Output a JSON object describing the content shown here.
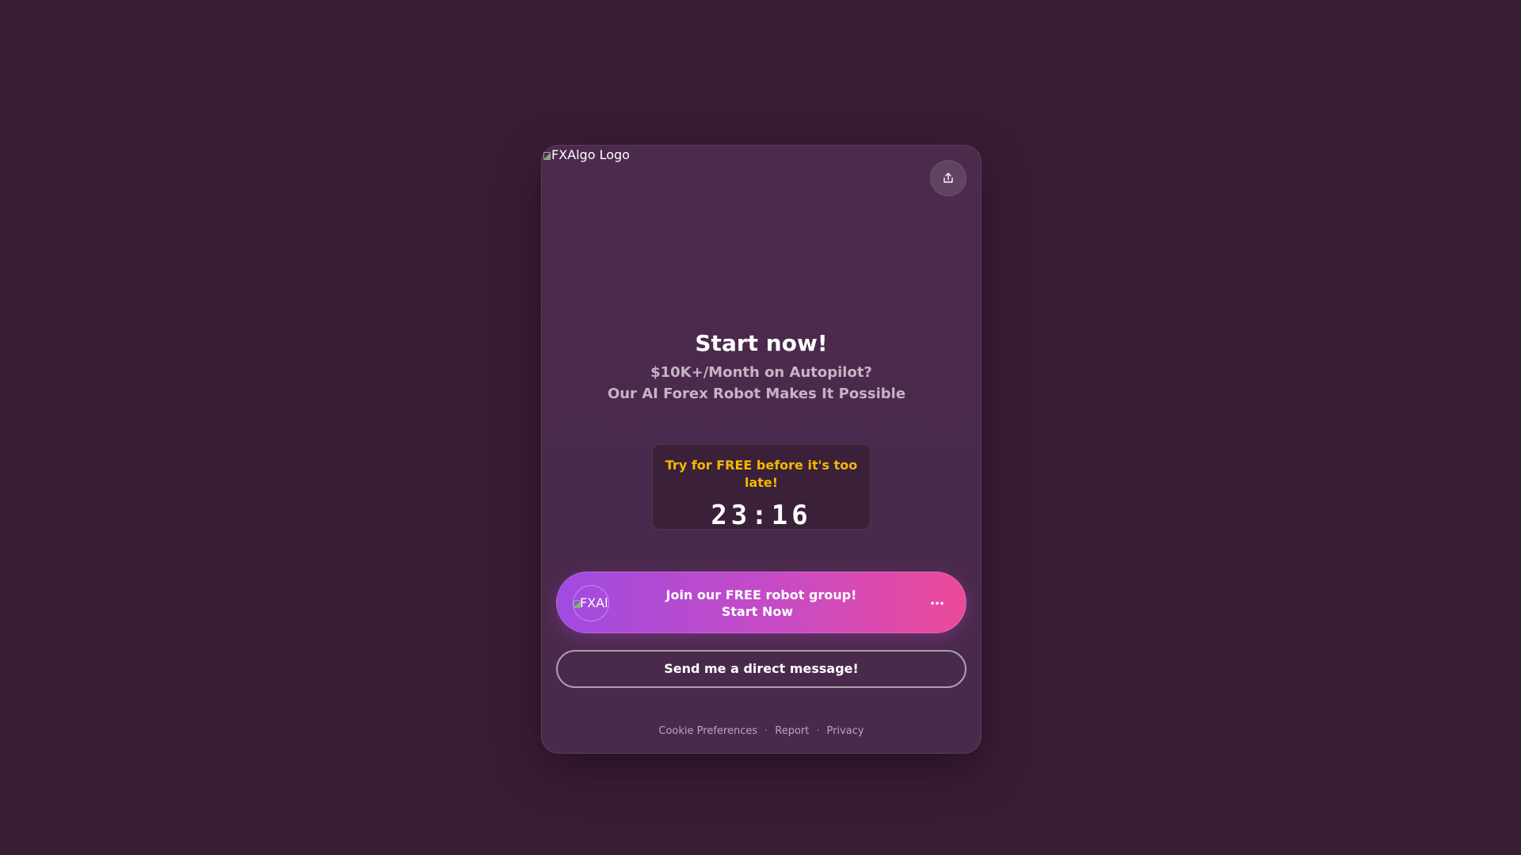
{
  "logo": {
    "alt_text": "FXAlgo Logo"
  },
  "share_button": {
    "icon": "share-icon"
  },
  "hero": {
    "title": "Start now!",
    "subtitle_line1": "$10K+/Month on Autopilot?",
    "subtitle_line2": "Our AI Forex Robot Makes It Possible"
  },
  "timer": {
    "label": "Try for FREE before it's too late!",
    "value": "23:16"
  },
  "cta": {
    "avatar_alt": "FXAlgo",
    "line1": "Join our FREE robot group!",
    "line2": "Start Now",
    "more_icon": "more-horizontal-icon"
  },
  "dm_button": {
    "label": "Send me a direct message!"
  },
  "footer": {
    "links": [
      "Cookie Preferences",
      "Report",
      "Privacy"
    ],
    "separator": "·"
  },
  "colors": {
    "background": "#3a1c36",
    "card": "#4b2a4c",
    "accent_yellow": "#f5b800",
    "gradient_start": "#a04be0",
    "gradient_end": "#ec4a9a"
  }
}
